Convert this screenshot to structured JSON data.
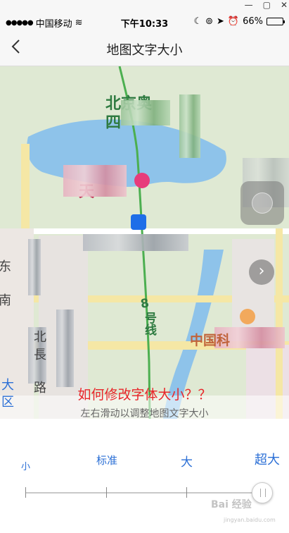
{
  "status_bar": {
    "carrier": "中国移动",
    "time": "下午10:33",
    "battery": "66%",
    "battery_level": 0.66
  },
  "nav": {
    "title": "地图文字大小"
  },
  "map": {
    "labels": {
      "north": "北京奥",
      "west": "四",
      "tian": "天",
      "line": "8",
      "hao": "号线",
      "zhongguo": "中国科",
      "dong": "东",
      "nan": "南",
      "bei": "北",
      "zhang": "長",
      "lu": "路",
      "left_big": "大",
      "left_qu": "区"
    }
  },
  "overlay": {
    "question": "如何修改字体大小？？",
    "hint": "左右滑动以调整地图文字大小"
  },
  "sizes": {
    "small": "小",
    "standard": "标准",
    "large": "大",
    "xlarge": "超大",
    "selected_level": 4,
    "level_count": 4
  },
  "watermark": {
    "main": "Bai 经验",
    "sub": "jingyan.baidu.com"
  },
  "colors": {
    "accent": "#2b6fd6",
    "question": "#e8262a",
    "map_green": "#2e7a40",
    "water": "#8ec3ea"
  }
}
